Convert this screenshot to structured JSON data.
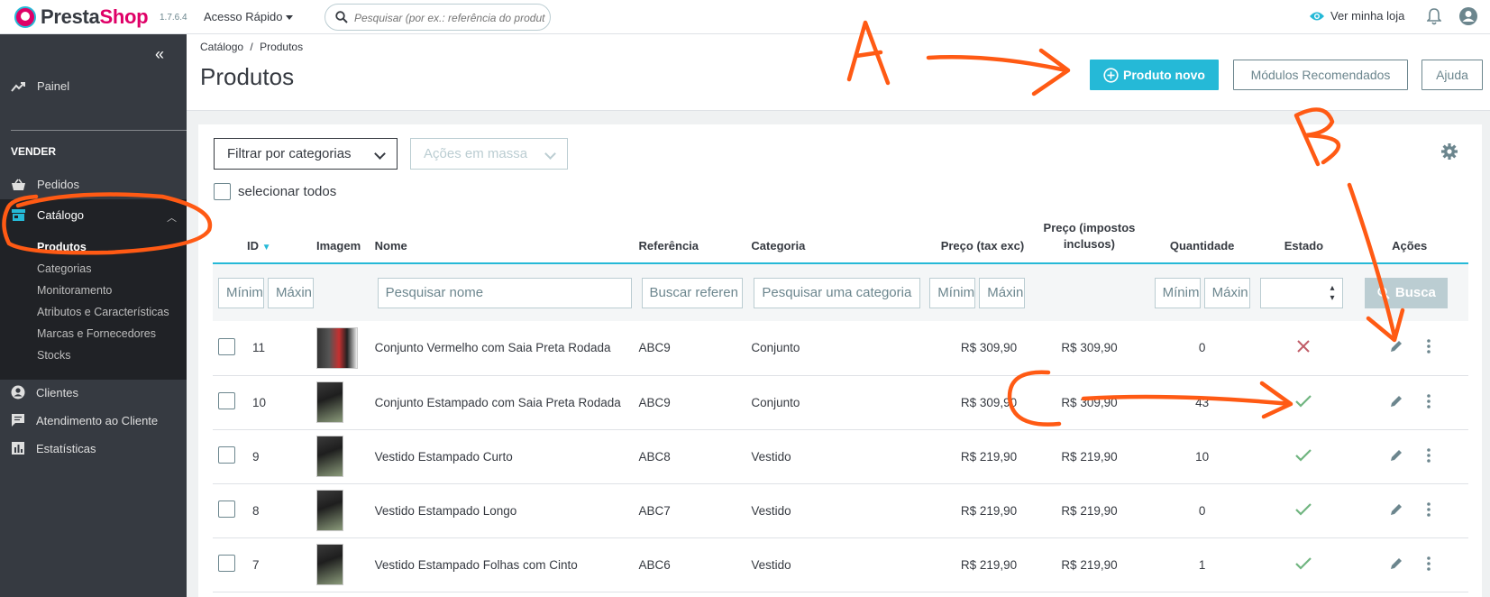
{
  "app": {
    "brand_a": "Presta",
    "brand_b": "Shop",
    "version": "1.7.6.4",
    "quick_access": "Acesso Rápido",
    "search_placeholder": "Pesquisar (por ex.: referência do produt",
    "view_store": "Ver minha loja"
  },
  "sidebar": {
    "painel": "Painel",
    "section_sell": "VENDER",
    "pedidos": "Pedidos",
    "catalogo": "Catálogo",
    "sub_items": [
      "Produtos",
      "Categorias",
      "Monitoramento",
      "Atributos e Características",
      "Marcas e Fornecedores",
      "Stocks"
    ],
    "clientes": "Clientes",
    "atendimento": "Atendimento ao Cliente",
    "estatisticas": "Estatísticas"
  },
  "header": {
    "breadcrumb_1": "Catálogo",
    "breadcrumb_sep": "/",
    "breadcrumb_2": "Produtos",
    "title": "Produtos",
    "new_product": "Produto novo",
    "recommended_modules": "Módulos Recomendados",
    "help": "Ajuda"
  },
  "toolbar": {
    "filter_categories": "Filtrar por categorias",
    "bulk_actions": "Ações em massa",
    "select_all": "selecionar todos"
  },
  "table": {
    "columns": {
      "id": "ID",
      "image": "Imagem",
      "name": "Nome",
      "reference": "Referência",
      "category": "Categoria",
      "price_tax_exc": "Preço (tax exc)",
      "price_tax_inc_1": "Preço (impostos",
      "price_tax_inc_2": "inclusos)",
      "quantity": "Quantidade",
      "status": "Estado",
      "actions": "Ações"
    },
    "filters": {
      "min": "Mínim",
      "max": "Máxin",
      "search_name": "Pesquisar nome",
      "search_ref": "Buscar referen",
      "search_category": "Pesquisar uma categoria",
      "search_button": "Busca"
    },
    "rows": [
      {
        "id": "11",
        "name": "Conjunto Vermelho com Saia Preta Rodada",
        "reference": "ABC9",
        "category": "Conjunto",
        "price_exc": "R$ 309,90",
        "price_inc": "R$ 309,90",
        "quantity": "0",
        "active": false
      },
      {
        "id": "10",
        "name": "Conjunto Estampado com Saia Preta Rodada",
        "reference": "ABC9",
        "category": "Conjunto",
        "price_exc": "R$ 309,90",
        "price_inc": "R$ 309,90",
        "quantity": "43",
        "active": true
      },
      {
        "id": "9",
        "name": "Vestido Estampado Curto",
        "reference": "ABC8",
        "category": "Vestido",
        "price_exc": "R$ 219,90",
        "price_inc": "R$ 219,90",
        "quantity": "10",
        "active": true
      },
      {
        "id": "8",
        "name": "Vestido Estampado Longo",
        "reference": "ABC7",
        "category": "Vestido",
        "price_exc": "R$ 219,90",
        "price_inc": "R$ 219,90",
        "quantity": "0",
        "active": true
      },
      {
        "id": "7",
        "name": "Vestido Estampado Folhas com Cinto",
        "reference": "ABC6",
        "category": "Vestido",
        "price_exc": "R$ 219,90",
        "price_inc": "R$ 219,90",
        "quantity": "1",
        "active": true
      }
    ]
  },
  "annotations": {
    "label_a": "A",
    "label_b": "B",
    "label_c": "C",
    "color": "#ff5a14"
  },
  "colors": {
    "accent": "#25b9d7",
    "sidebar": "#363a41",
    "success": "#70b580",
    "danger": "#c05c67",
    "brand_pink": "#df0067"
  }
}
